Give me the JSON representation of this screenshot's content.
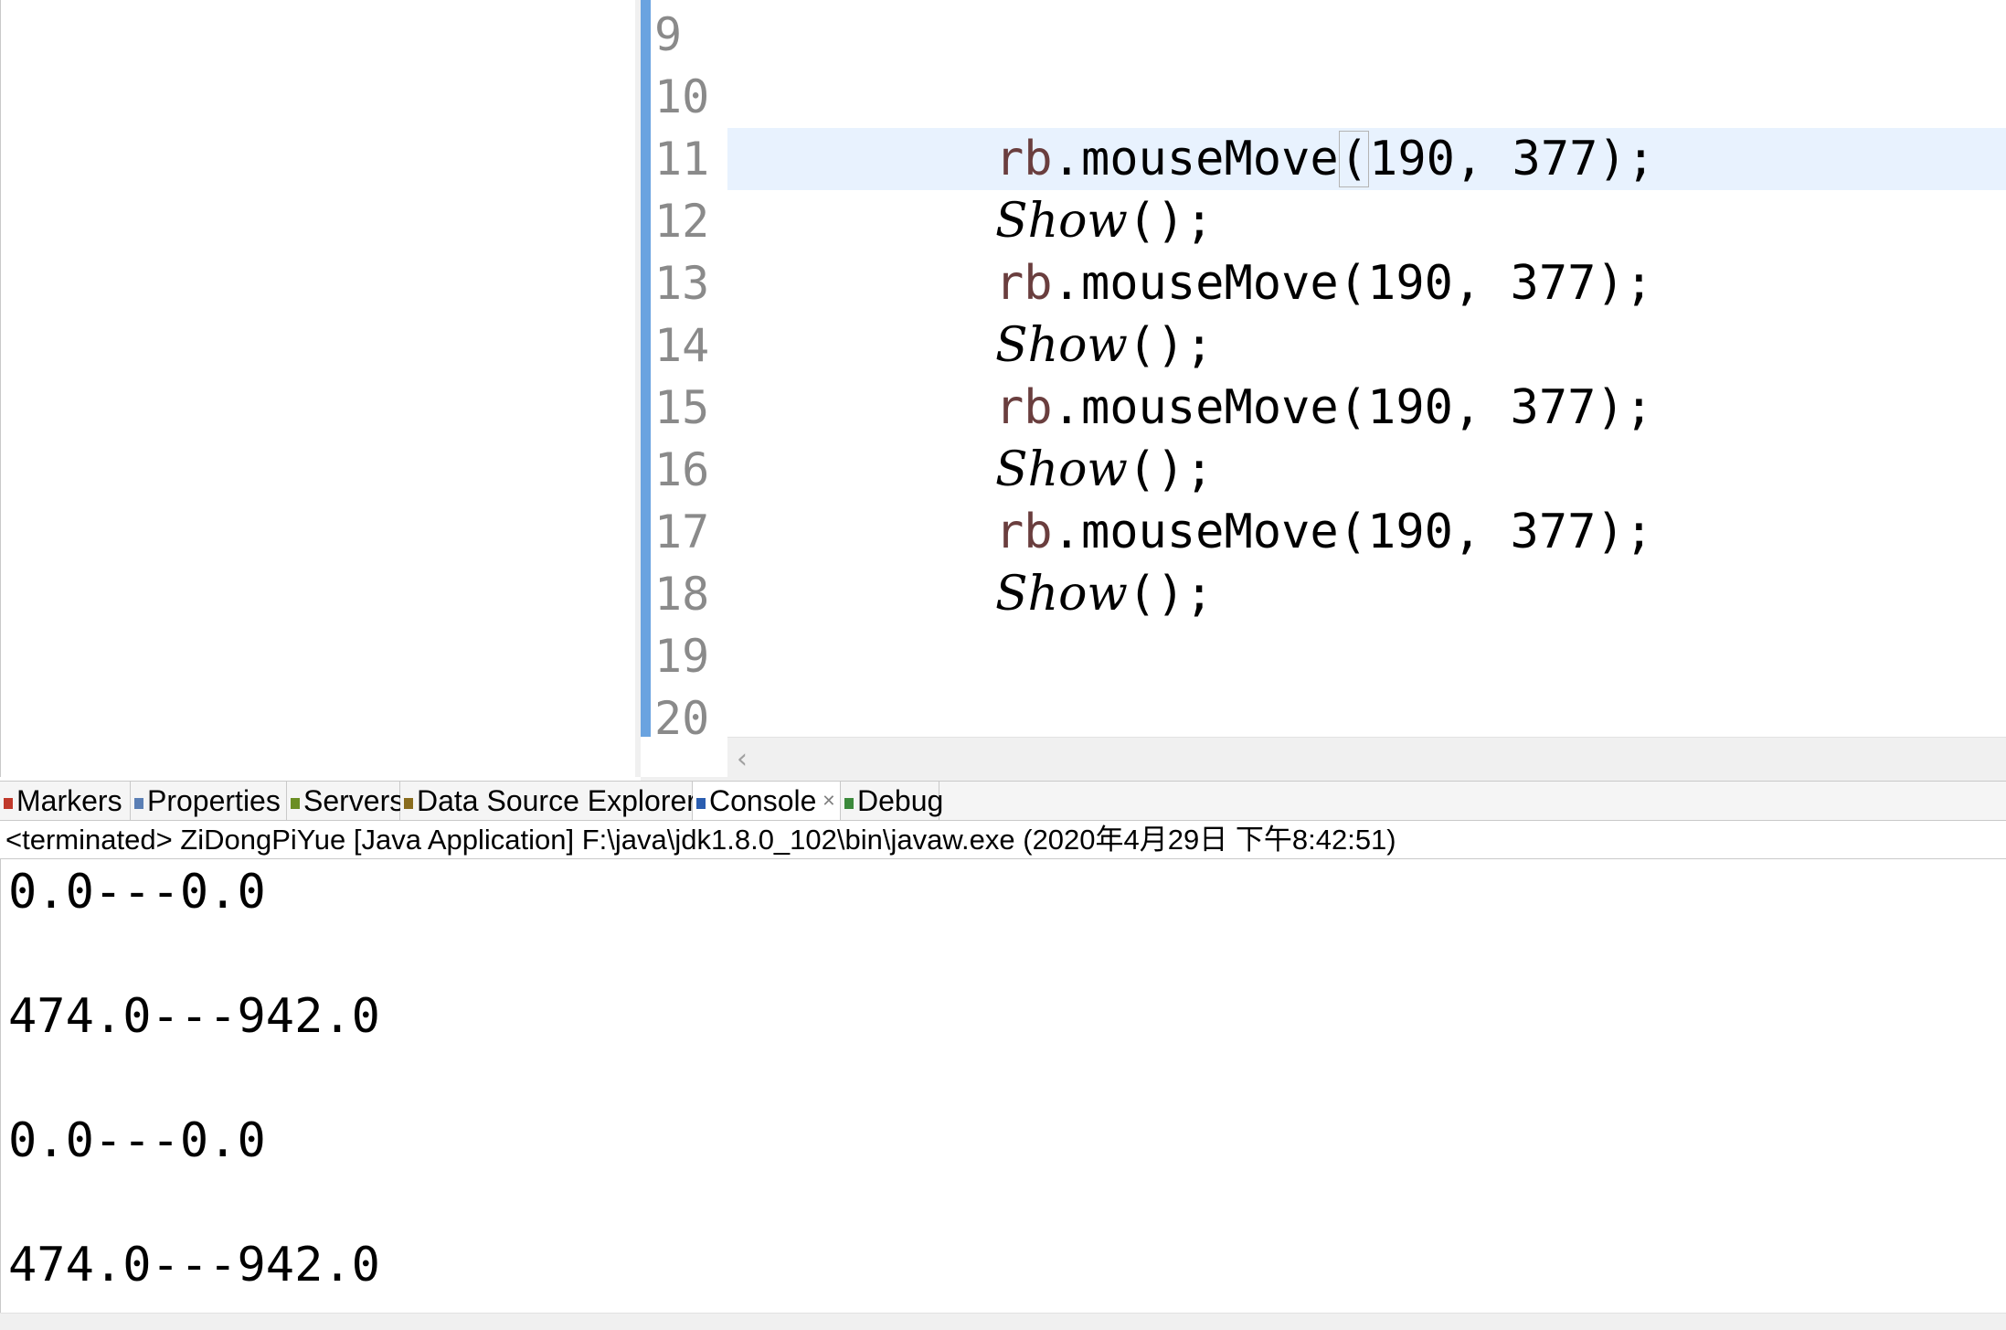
{
  "editor": {
    "lines": [
      {
        "num": "9",
        "tokens": []
      },
      {
        "num": "10",
        "tokens": []
      },
      {
        "num": "11",
        "current": true,
        "tokens": [
          [
            "var",
            "rb"
          ],
          [
            "punct",
            "."
          ],
          [
            "method",
            "mouseMove"
          ],
          [
            "bracket",
            "("
          ],
          [
            "num",
            "190, 377"
          ],
          [
            "punct",
            ");"
          ]
        ]
      },
      {
        "num": "12",
        "tokens": [
          [
            "static",
            "Show"
          ],
          [
            "punct",
            "();"
          ]
        ]
      },
      {
        "num": "13",
        "tokens": [
          [
            "var",
            "rb"
          ],
          [
            "punct",
            "."
          ],
          [
            "method",
            "mouseMove"
          ],
          [
            "punct",
            "("
          ],
          [
            "num",
            "190, 377"
          ],
          [
            "punct",
            ");"
          ]
        ]
      },
      {
        "num": "14",
        "tokens": [
          [
            "static",
            "Show"
          ],
          [
            "punct",
            "();"
          ]
        ]
      },
      {
        "num": "15",
        "tokens": [
          [
            "var",
            "rb"
          ],
          [
            "punct",
            "."
          ],
          [
            "method",
            "mouseMove"
          ],
          [
            "punct",
            "("
          ],
          [
            "num",
            "190, 377"
          ],
          [
            "punct",
            ");"
          ]
        ]
      },
      {
        "num": "16",
        "tokens": [
          [
            "static",
            "Show"
          ],
          [
            "punct",
            "();"
          ]
        ]
      },
      {
        "num": "17",
        "tokens": [
          [
            "var",
            "rb"
          ],
          [
            "punct",
            "."
          ],
          [
            "method",
            "mouseMove"
          ],
          [
            "punct",
            "("
          ],
          [
            "num",
            "190, 377"
          ],
          [
            "punct",
            ");"
          ]
        ]
      },
      {
        "num": "18",
        "tokens": [
          [
            "static",
            "Show"
          ],
          [
            "punct",
            "();"
          ]
        ]
      },
      {
        "num": "19",
        "tokens": []
      },
      {
        "num": "20",
        "tokens": []
      }
    ],
    "scroll_left_glyph": "‹"
  },
  "tabs": [
    {
      "id": "markers",
      "label": "Markers",
      "icon": "markers-icon",
      "color": "#c0392b"
    },
    {
      "id": "properties",
      "label": "Properties",
      "icon": "properties-icon",
      "color": "#5b7fb5"
    },
    {
      "id": "servers",
      "label": "Servers",
      "icon": "servers-icon",
      "color": "#6b8e23"
    },
    {
      "id": "data-source-explorer",
      "label": "Data Source Explorer",
      "icon": "database-icon",
      "color": "#8a6d1f"
    },
    {
      "id": "console",
      "label": "Console",
      "icon": "console-icon",
      "color": "#2a5db0",
      "active": true,
      "close": "✕"
    },
    {
      "id": "debug",
      "label": "Debug",
      "icon": "debug-icon",
      "color": "#3c8a3c"
    }
  ],
  "console": {
    "header": "<terminated> ZiDongPiYue [Java Application] F:\\java\\jdk1.8.0_102\\bin\\javaw.exe (2020年4月29日 下午8:42:51)",
    "output": [
      "0.0---0.0",
      "",
      "474.0---942.0",
      "",
      "0.0---0.0",
      "",
      "474.0---942.0"
    ]
  }
}
